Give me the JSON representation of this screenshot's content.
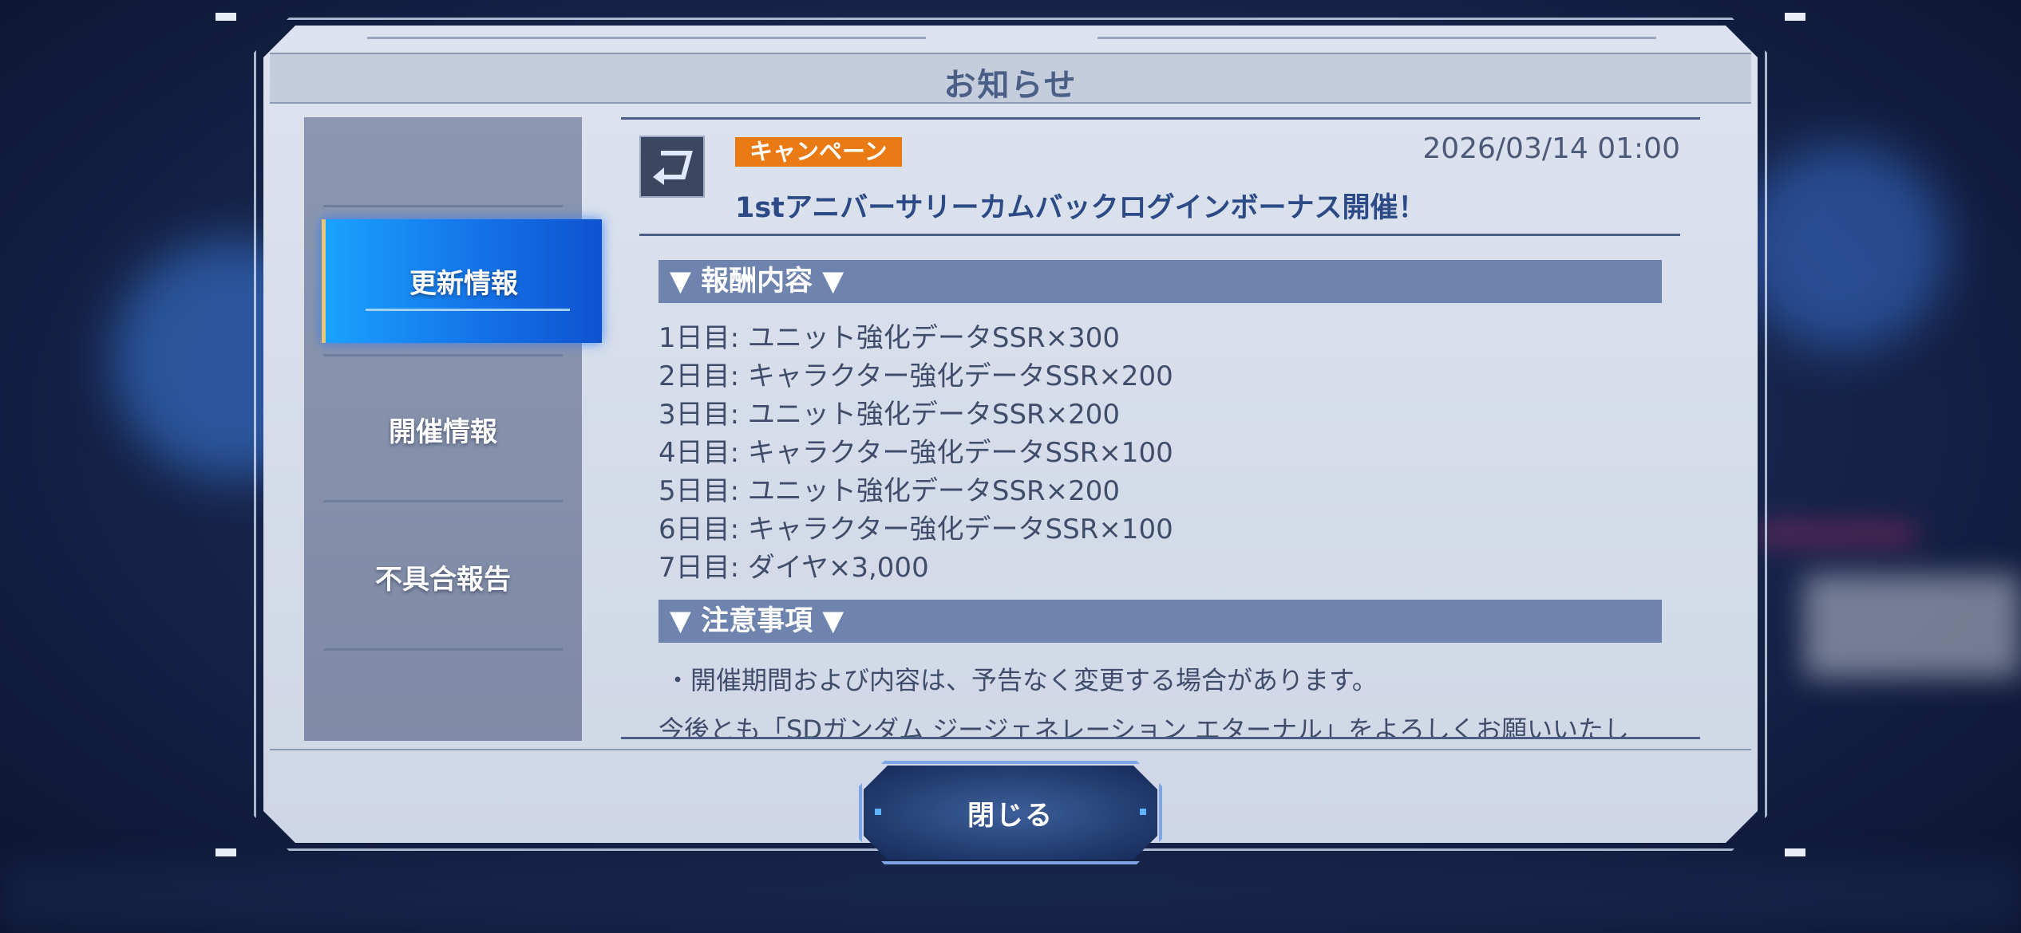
{
  "dialog": {
    "title": "お知らせ"
  },
  "sidebar": {
    "items": [
      {
        "label": "更新情報",
        "active": true
      },
      {
        "label": "開催情報",
        "active": false
      },
      {
        "label": "不具合報告",
        "active": false
      }
    ]
  },
  "notice": {
    "icon": "return-arrow-icon",
    "badge": "キャンペーン",
    "date": "2026/03/14 01:00",
    "headline": "1stアニバーサリーカムバックログインボーナス開催！",
    "sections": [
      {
        "header": "▼ 報酬内容 ▼",
        "items": [
          "1日目: ユニット強化データSSR×300",
          "2日目: キャラクター強化データSSR×200",
          "3日目: ユニット強化データSSR×200",
          "4日目: キャラクター強化データSSR×100",
          "5日目: ユニット強化データSSR×200",
          "6日目: キャラクター強化データSSR×100",
          "7日目: ダイヤ×3,000"
        ]
      },
      {
        "header": "▼ 注意事項 ▼",
        "items": [
          "・開催期間および内容は、予告なく変更する場合があります。"
        ]
      }
    ],
    "closing": "今後とも「SDガンダム ジージェネレーション エターナル」をよろしくお願いいたし"
  },
  "footer": {
    "close_label": "閉じる"
  },
  "colors": {
    "accent": "#1473e8",
    "badge": "#ea7a14",
    "section_header": "#6e83ad"
  }
}
